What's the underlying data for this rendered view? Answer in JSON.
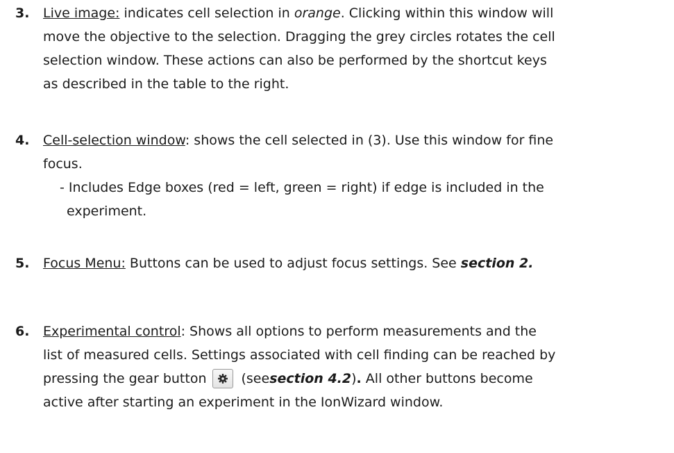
{
  "items": [
    {
      "number": "3.",
      "title": "Live image:",
      "lines": [
        {
          "pre": " indicates cell selection in ",
          "em": "orange",
          "post": ". Clicking within this window will"
        },
        "move the objective to the selection. Dragging the grey circles rotates the cell",
        "selection window. These actions can also be performed by the shortcut keys",
        "as described in the table to the right."
      ]
    },
    {
      "number": "4.",
      "title": "Cell-selection window",
      "first_rest": ": shows the cell selected in (3). Use this window for fine",
      "line2": "focus.",
      "sub_line1": "- Includes Edge boxes (red = left, green = right) if edge is included in the",
      "sub_line2": "experiment."
    },
    {
      "number": "5.",
      "title": "Focus Menu:",
      "rest": " Buttons can be used to adjust focus settings. See ",
      "ref": "section 2."
    },
    {
      "number": "6.",
      "title": "Experimental control",
      "first_rest": ": Shows all options to perform measurements and the",
      "line2": "list of measured cells. Settings associated with cell finding can be reached by",
      "line3_pre": "pressing the gear button",
      "line3_mid": "(see ",
      "line3_ref": "section 4.2",
      "line3_post1": ")",
      "line3_dot": ".",
      "line3_post2": " All other buttons become",
      "line4": "active after starting an experiment in the IonWizard window.",
      "gear_icon": "gear-icon"
    }
  ]
}
